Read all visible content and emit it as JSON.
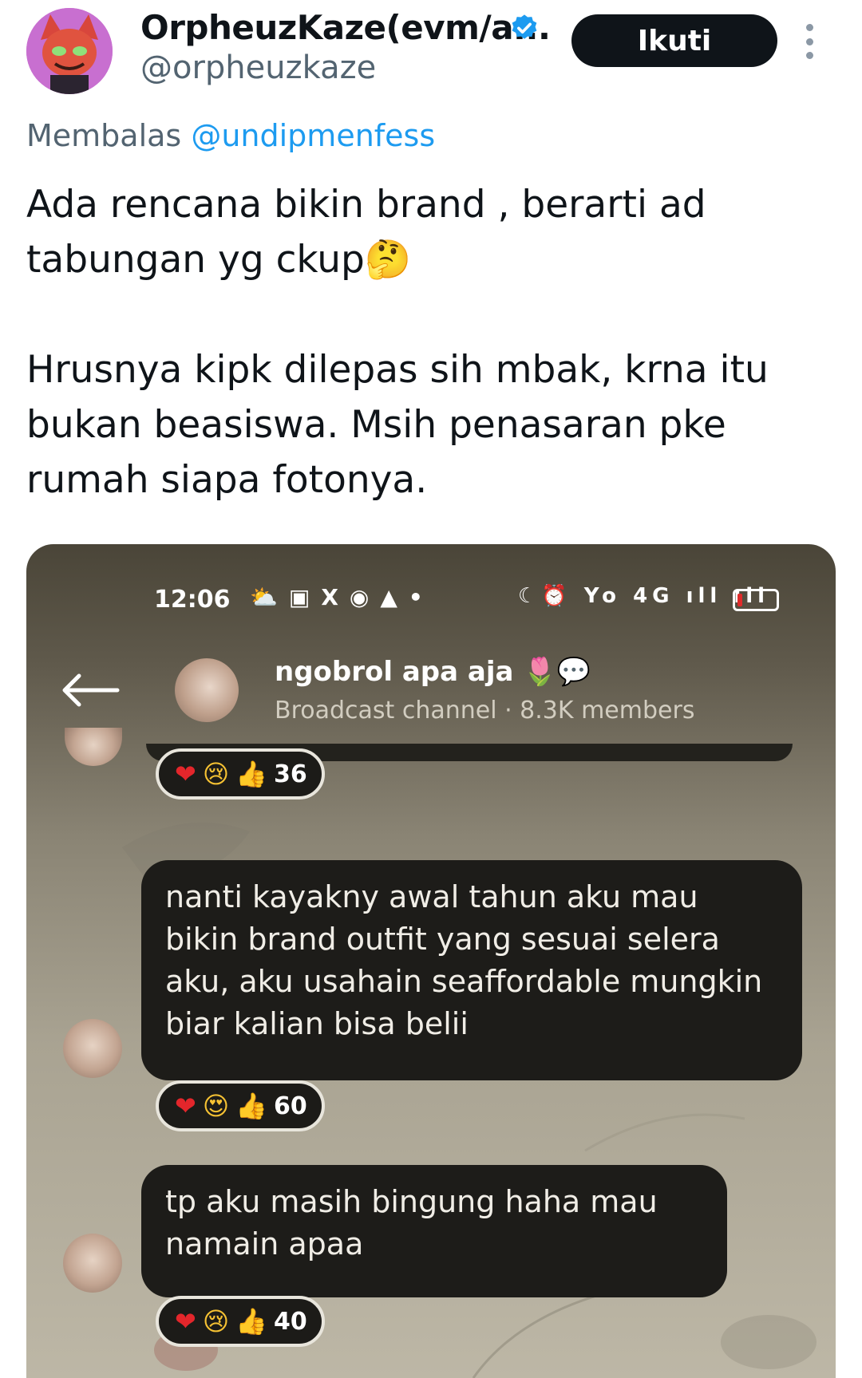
{
  "author": {
    "display_name": "OrpheuzKaze(evm/a...",
    "handle": "@orpheuzkaze",
    "follow_label": "Ikuti"
  },
  "reply": {
    "prefix": "Membalas",
    "mention": "@undipmenfess"
  },
  "tweet": {
    "line1": "Ada rencana bikin brand , berarti ad",
    "line2": "tabungan yg ckup🤔",
    "line3": "Hrusnya kipk dilepas sih mbak, krna itu",
    "line4": "bukan beasiswa. Msih penasaran pke",
    "line5": "rumah siapa fotonya."
  },
  "media": {
    "status": {
      "time": "12:06",
      "left_icons": "⛅▣X◉▲•",
      "right_icons": "☾⏰ Yo 4G ıll ıll"
    },
    "channel": {
      "name": "ngobrol apa aja 🌷💬",
      "subtitle": "Broadcast channel · 8.3K members"
    },
    "messages": [
      {
        "text": "",
        "reactions": [
          "❤",
          "😢",
          "👍"
        ],
        "count": "36"
      },
      {
        "text": "nanti kayakny awal tahun aku mau bikin brand outfit yang sesuai selera aku, aku usahain seaffordable mungkin biar kalian bisa belii",
        "reactions": [
          "❤",
          "😍",
          "👍"
        ],
        "count": "60"
      },
      {
        "text": "tp aku masih bingung haha mau namain apaa",
        "reactions": [
          "❤",
          "😢",
          "👍"
        ],
        "count": "40"
      }
    ]
  },
  "icons": {
    "verified": "verified-badge-icon",
    "more": "more-vertical-icon",
    "back": "back-arrow-icon"
  },
  "colors": {
    "follow_button": "#0f1419",
    "mention": "#1d9bf0",
    "verified": "#1d9bf0",
    "secondary_text": "#536471",
    "heart": "#e3262b"
  }
}
